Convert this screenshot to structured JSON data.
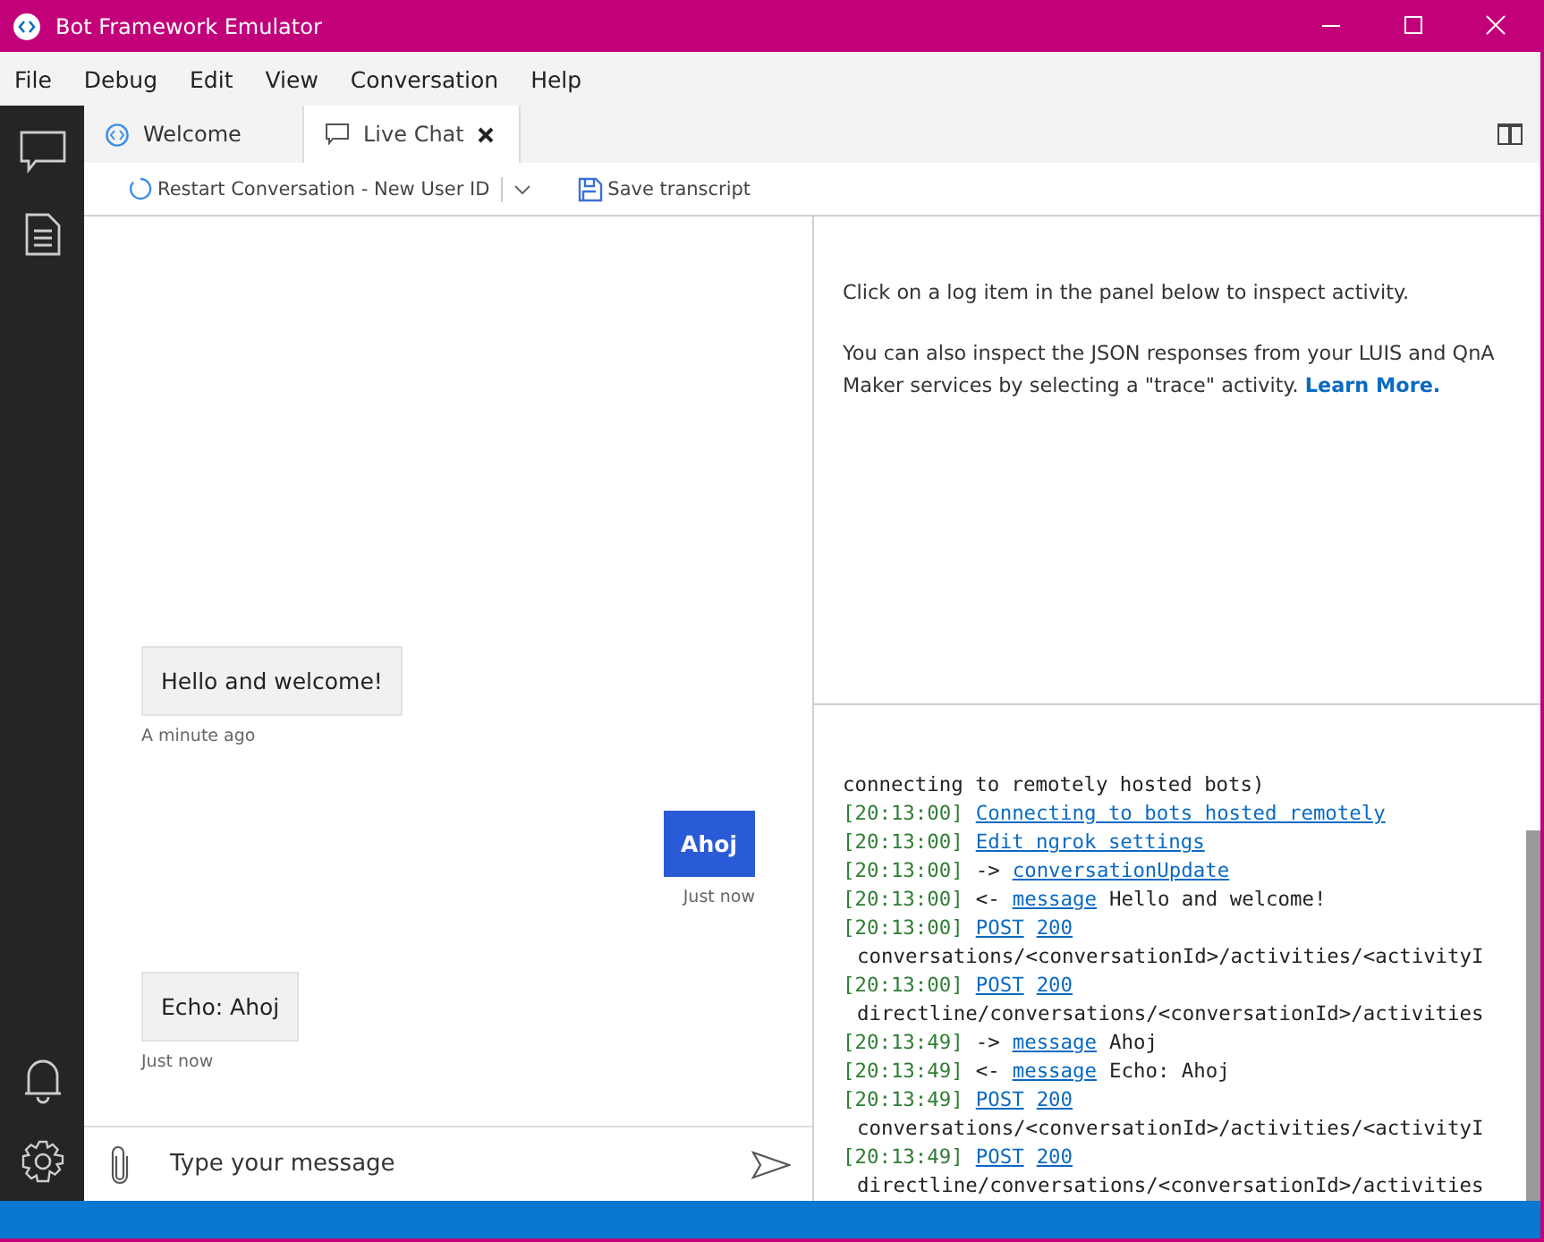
{
  "window": {
    "title": "Bot Framework Emulator"
  },
  "menu": [
    "File",
    "Debug",
    "Edit",
    "View",
    "Conversation",
    "Help"
  ],
  "tabs": [
    {
      "label": "Welcome",
      "kind": "welcome",
      "selected": false
    },
    {
      "label": "Live Chat",
      "kind": "chat",
      "selected": true
    }
  ],
  "toolbar": {
    "restart": "Restart Conversation - New User ID",
    "save": "Save transcript"
  },
  "chat": {
    "messages": [
      {
        "kind": "bot",
        "text": "Hello and welcome!",
        "time": "A minute ago"
      },
      {
        "kind": "user",
        "text": "Ahoj",
        "time": "Just now"
      },
      {
        "kind": "bot",
        "text": "Echo: Ahoj",
        "time": "Just now"
      }
    ],
    "input": {
      "placeholder": "Type your message"
    }
  },
  "inspector": {
    "hint": "Click on a log item in the panel below to inspect activity.",
    "info": "You can also inspect the JSON responses from your LUIS and QnA Maker services by selecting a \"trace\" activity.",
    "link": "Learn More."
  },
  "log": [
    {
      "text": "connecting to remotely hosted bots)"
    },
    {
      "time": "[20:13:00]",
      "links": [
        "Connecting to bots hosted remotely"
      ]
    },
    {
      "time": "[20:13:00]",
      "links": [
        "Edit ngrok settings"
      ]
    },
    {
      "time": "[20:13:00]",
      "arrow": "->",
      "links": [
        "conversationUpdate"
      ]
    },
    {
      "time": "[20:13:00]",
      "arrow": "<-",
      "links": [
        "message"
      ],
      "text": "Hello and welcome!"
    },
    {
      "time": "[20:13:00]",
      "links": [
        "POST",
        "200"
      ],
      "path": "conversations/<conversationId>/activities/<activityI"
    },
    {
      "time": "[20:13:00]",
      "links": [
        "POST",
        "200"
      ],
      "path": "directline/conversations/<conversationId>/activities"
    },
    {
      "time": "[20:13:49]",
      "arrow": "->",
      "links": [
        "message"
      ],
      "text": "Ahoj"
    },
    {
      "time": "[20:13:49]",
      "arrow": "<-",
      "links": [
        "message"
      ],
      "text": "Echo: Ahoj"
    },
    {
      "time": "[20:13:49]",
      "links": [
        "POST",
        "200"
      ],
      "path": "conversations/<conversationId>/activities/<activityI"
    },
    {
      "time": "[20:13:49]",
      "links": [
        "POST",
        "200"
      ],
      "path": "directline/conversations/<conversationId>/activities"
    }
  ]
}
